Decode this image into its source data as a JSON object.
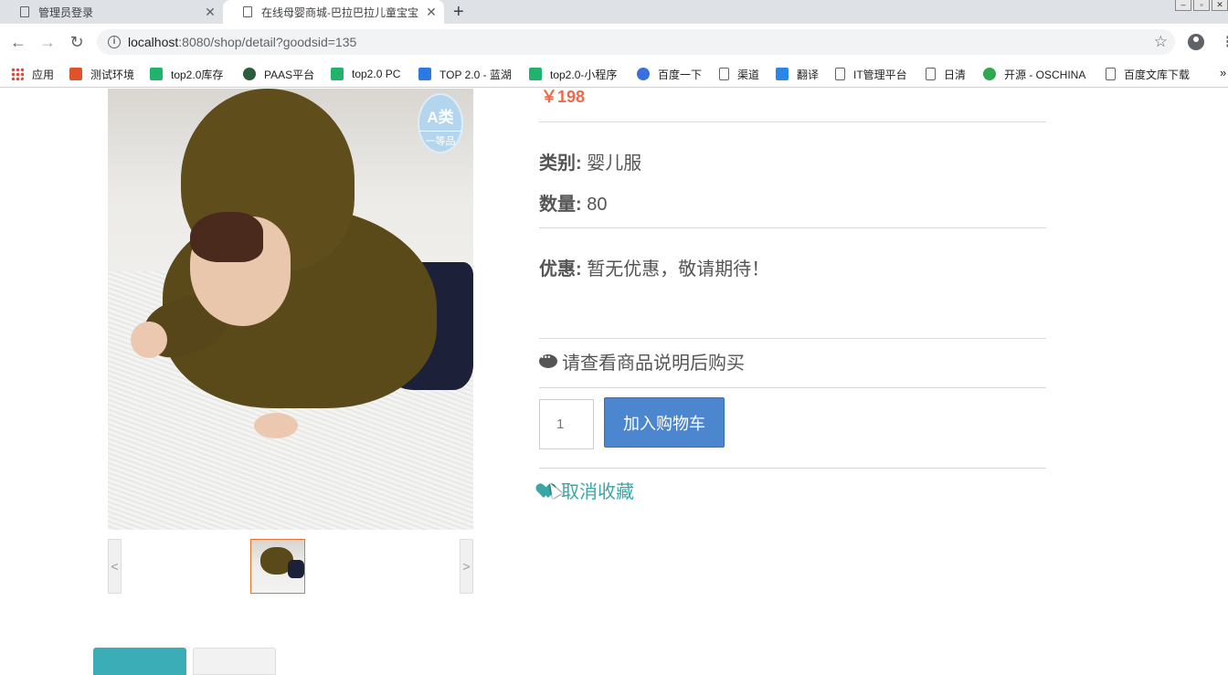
{
  "browser": {
    "tabs": [
      {
        "title": "管理员登录"
      },
      {
        "title": "在线母婴商城-巴拉巴拉儿童宝宝"
      }
    ],
    "url_host": "localhost",
    "url_rest": ":8080/shop/detail?goodsid=135",
    "bookmarks": [
      {
        "label": "应用",
        "icon": "apps-icon"
      },
      {
        "label": "测试环境",
        "icon": "u-logo-icon",
        "color": "#e0522c"
      },
      {
        "label": "top2.0库存",
        "icon": "play-icon",
        "color": "#1fb36b"
      },
      {
        "label": "PAAS平台",
        "icon": "globe-icon",
        "color": "#2b5d3a"
      },
      {
        "label": "top2.0 PC",
        "icon": "play-icon",
        "color": "#1fb36b"
      },
      {
        "label": "TOP 2.0 - 蓝湖",
        "icon": "lanhu-icon",
        "color": "#2a7ae2"
      },
      {
        "label": "top2.0-小程序",
        "icon": "play-icon",
        "color": "#1fb36b"
      },
      {
        "label": "百度一下",
        "icon": "paw-icon",
        "color": "#3a6fe0"
      },
      {
        "label": "渠道",
        "icon": "page-icon"
      },
      {
        "label": "翻译",
        "icon": "translate-icon",
        "color": "#2a86e8"
      },
      {
        "label": "IT管理平台",
        "icon": "page-icon"
      },
      {
        "label": "日清",
        "icon": "page-icon"
      },
      {
        "label": "开源 - OSCHINA",
        "icon": "oschina-icon",
        "color": "#2fa84f"
      },
      {
        "label": "百度文库下载",
        "icon": "page-icon"
      }
    ]
  },
  "product": {
    "badge_line1": "A类",
    "badge_line2": "一等品",
    "price": "￥198",
    "category_label": "类别:",
    "category_value": "婴儿服",
    "quantity_label": "数量:",
    "quantity_value": "80",
    "discount_label": "优惠:",
    "discount_value": "暂无优惠，敬请期待！",
    "notice": "请查看商品说明后购买",
    "qty_input": "1",
    "add_to_cart": "加入购物车",
    "unfavorite": "取消收藏",
    "thumb_prev": "<",
    "thumb_next": ">"
  },
  "colors": {
    "price": "#f0694a",
    "primary_button": "#4b86cf",
    "favorite": "#3aa6a6",
    "active_tab": "#3aadb6"
  }
}
